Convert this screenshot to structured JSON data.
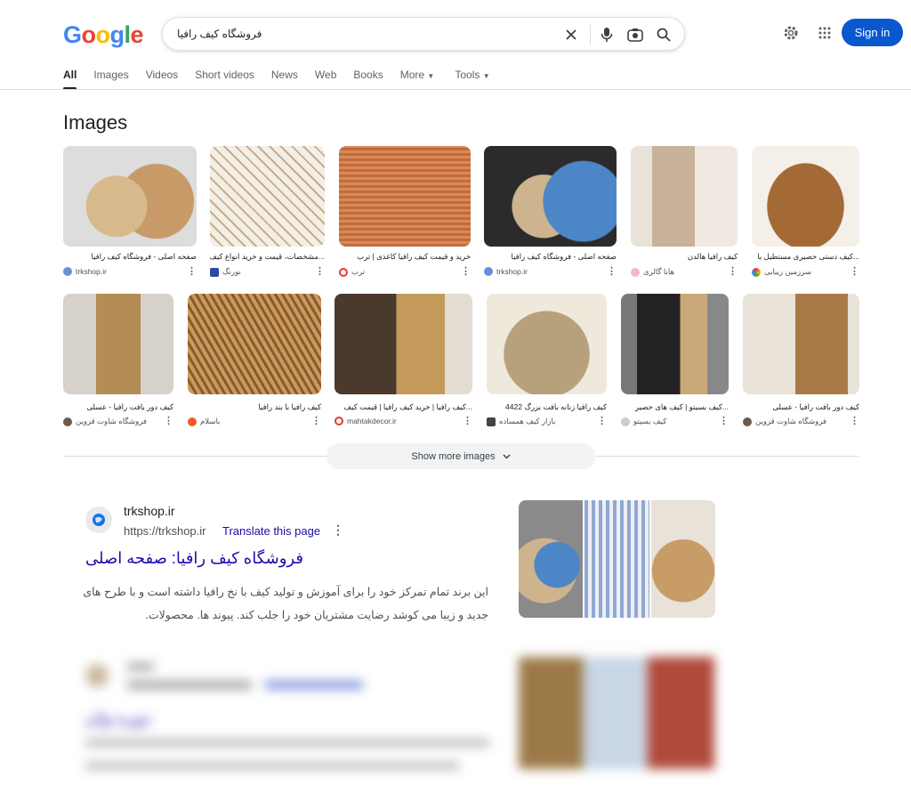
{
  "header": {
    "logo": "Google",
    "search_query": "فروشگاه کیف رافیا",
    "sign_in_label": "Sign in"
  },
  "tabs": [
    "All",
    "Images",
    "Videos",
    "Short videos",
    "News",
    "Web",
    "Books",
    "More",
    "Tools"
  ],
  "images_section": {
    "title": "Images",
    "row1": [
      {
        "caption": "صفحه اصلی - فروشگاه کیف رافیا",
        "source": "trkshop.ir"
      },
      {
        "caption": "...مشخصات، قیمت و خرید انواع کیف",
        "source": "نورنگ"
      },
      {
        "caption": "خرید و قیمت کیف رافیا کاغذی | ترب",
        "source": "ترب"
      },
      {
        "caption": "صفحه اصلی - فروشگاه کیف رافیا",
        "source": "trkshop.ir"
      },
      {
        "caption": "کیف رافیا هالدن",
        "source": "هانا گالری"
      },
      {
        "caption": "...کیف دستی حصیری مستطیل با",
        "source": "سرزمین زیبایی"
      }
    ],
    "row2": [
      {
        "caption": "کیف دور بافت رافیا - عسلی",
        "source": "فروشگاه شاوت قزوین"
      },
      {
        "caption": "کیف رافیا با بند رافیا",
        "source": "باسلام"
      },
      {
        "caption": "...کیف رافیا | خرید کیف رافیا | قیمت کیف",
        "source": "mahtakdecor.ir"
      },
      {
        "caption": "کیف رافیا زنانه بافت بزرگ 4422",
        "source": "بازار کیف همساده"
      },
      {
        "caption": "...کیف بسیتو | کیف های حصیر",
        "source": "کیف بسیتو"
      },
      {
        "caption": "کیف دور بافت رافیا - عسلی",
        "source": "فروشگاه شاوت قزوین"
      }
    ],
    "show_more_label": "Show more images"
  },
  "result": {
    "site": "trkshop.ir",
    "url": "https://trkshop.ir",
    "translate_label": "Translate this page",
    "title": "فروشگاه کیف رافیا: صفحه اصلی",
    "snippet": "این برند تمام تمرکز خود را برای آموزش و تولید کیف با نخ رافیا داشته است و با طرح های جدید و زیبا می کوشد رضایت مشتریان خود را جلب کند. پیوند ها. محصولات."
  },
  "blurred_result": {
    "title": "دوره وان",
    "snippet": "-"
  },
  "colors": {
    "accent": "#0b57d0",
    "link": "#1a0dab"
  }
}
